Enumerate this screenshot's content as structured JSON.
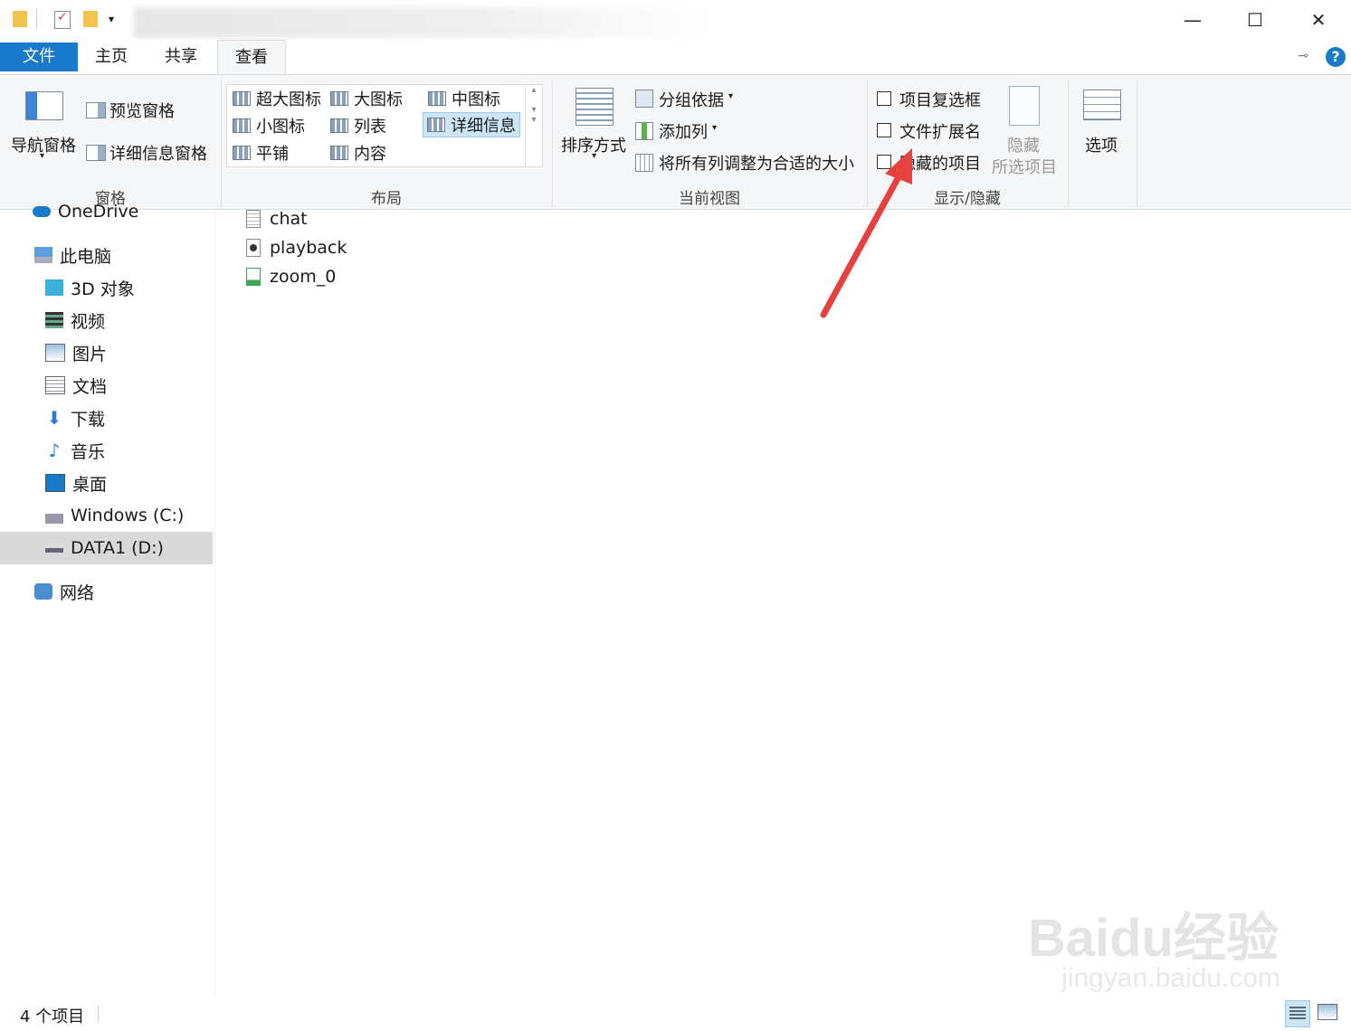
{
  "title_bar": {
    "minimize": "—",
    "maximize": "☐",
    "close": "✕"
  },
  "tabs": [
    {
      "label": "文件"
    },
    {
      "label": "主页"
    },
    {
      "label": "共享"
    },
    {
      "label": "查看"
    }
  ],
  "ribbon": {
    "pane_group": {
      "label": "窗格",
      "nav_pane": "导航窗格",
      "preview_pane": "预览窗格",
      "details_pane": "详细信息窗格"
    },
    "layout_group": {
      "label": "布局",
      "items": [
        "超大图标",
        "大图标",
        "中图标",
        "小图标",
        "列表",
        "详细信息",
        "平铺",
        "内容"
      ],
      "selected": "详细信息"
    },
    "current_view_group": {
      "label": "当前视图",
      "sort_by": "排序方式",
      "group_by": "分组依据",
      "add_columns": "添加列",
      "fit_columns": "将所有列调整为合适的大小"
    },
    "show_hide_group": {
      "label": "显示/隐藏",
      "item_checkboxes": "项目复选框",
      "file_extensions": "文件扩展名",
      "hidden_items": "隐藏的项目",
      "hide_selected_1": "隐藏",
      "hide_selected_2": "所选项目"
    },
    "options": "选项"
  },
  "nav": {
    "items": [
      {
        "label": "OneDrive"
      },
      {
        "label": "此电脑"
      },
      {
        "label": "3D 对象"
      },
      {
        "label": "视频"
      },
      {
        "label": "图片"
      },
      {
        "label": "文档"
      },
      {
        "label": "下载"
      },
      {
        "label": "音乐"
      },
      {
        "label": "桌面"
      },
      {
        "label": "Windows (C:)"
      },
      {
        "label": "DATA1 (D:)"
      },
      {
        "label": "网络"
      }
    ],
    "selected": "DATA1 (D:)"
  },
  "files": [
    {
      "name": "chat"
    },
    {
      "name": "playback"
    },
    {
      "name": "zoom_0"
    }
  ],
  "status": {
    "count": "4 个项目"
  },
  "watermark": {
    "line1": "Baidu经验",
    "line2": "jingyan.baidu.com"
  },
  "colors": {
    "accent": "#1979ca",
    "arrow": "#e8403e",
    "selection": "#cde6f7"
  }
}
